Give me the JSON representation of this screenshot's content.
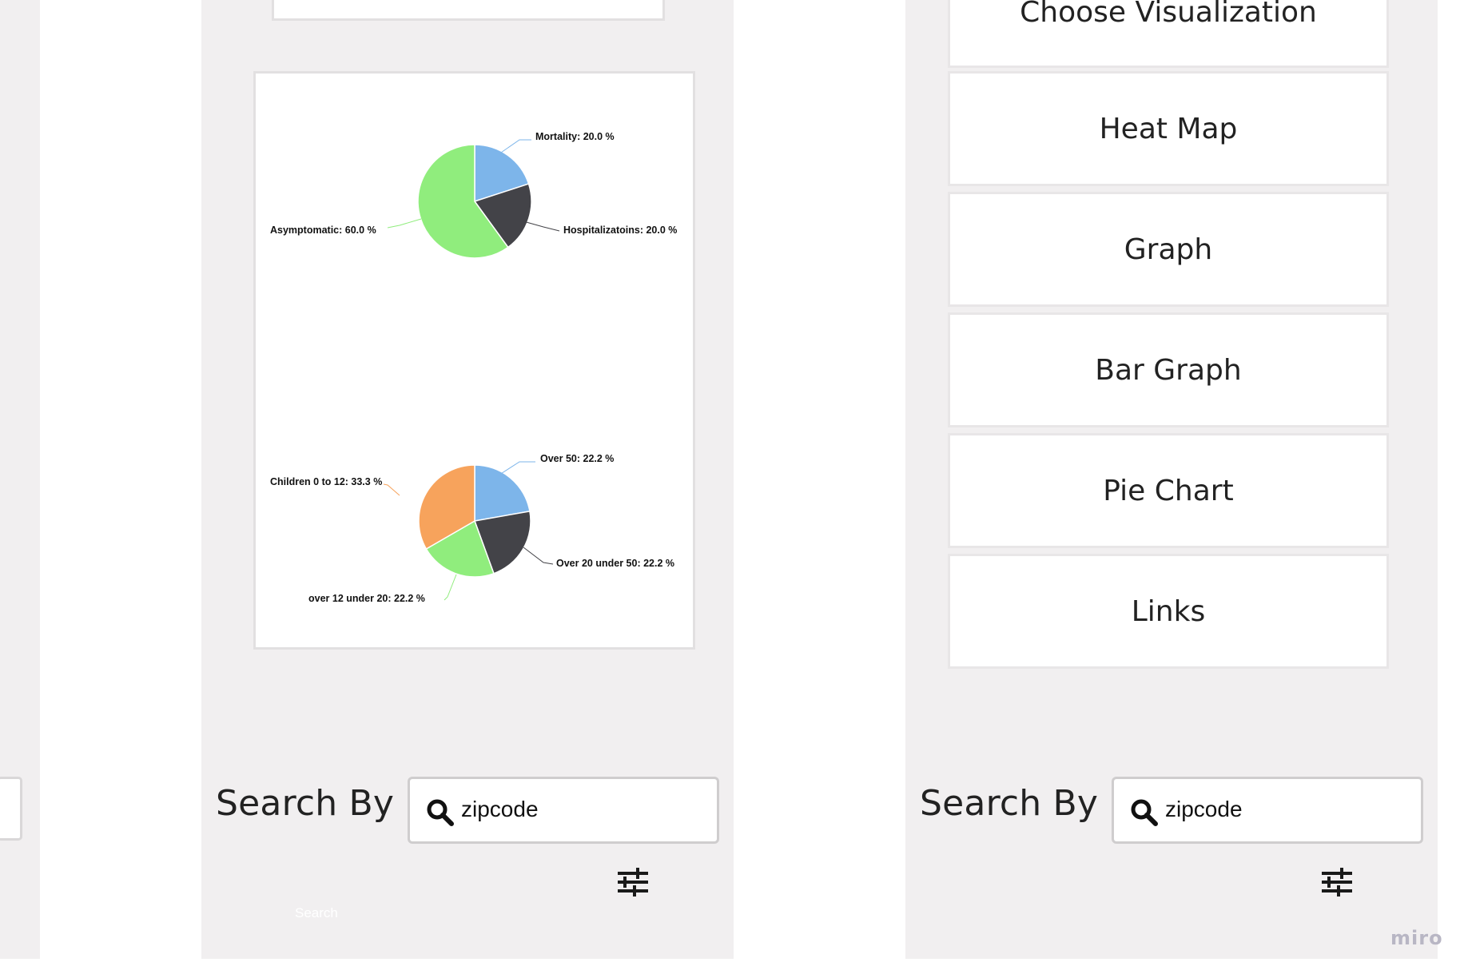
{
  "left_panel": {
    "search_label": "Search By",
    "search_value": "zipcode",
    "search_button_text": "Search"
  },
  "pie_charts": [
    {
      "slices": [
        {
          "label": "Mortality: 20.0 %",
          "value": 20.0,
          "color": "#7db5ea"
        },
        {
          "label": "Hospitalizatoins: 20.0 %",
          "value": 20.0,
          "color": "#434348"
        },
        {
          "label": "Asymptomatic: 60.0 %",
          "value": 60.0,
          "color": "#90ed7d"
        }
      ]
    },
    {
      "slices": [
        {
          "label": "Over 50: 22.2 %",
          "value": 22.2,
          "color": "#7db5ea"
        },
        {
          "label": "Over 20 under 50: 22.2 %",
          "value": 22.2,
          "color": "#434348"
        },
        {
          "label": "over 12 under 20: 22.2 %",
          "value": 22.2,
          "color": "#90ed7d"
        },
        {
          "label": "Children 0 to 12: 33.3 %",
          "value": 33.3,
          "color": "#f7a35c"
        }
      ]
    }
  ],
  "chart_data": [
    {
      "type": "pie",
      "categories": [
        "Mortality",
        "Hospitalizatoins",
        "Asymptomatic"
      ],
      "values": [
        20.0,
        20.0,
        60.0
      ]
    },
    {
      "type": "pie",
      "categories": [
        "Over 50",
        "Over 20 under 50",
        "over 12 under 20",
        "Children 0 to 12"
      ],
      "values": [
        22.2,
        22.2,
        22.2,
        33.3
      ]
    }
  ],
  "right_panel": {
    "menu": {
      "header": "Choose Visualization",
      "items": [
        "Heat Map",
        "Graph",
        "Bar Graph",
        "Pie Chart",
        "Links"
      ]
    },
    "search_label": "Search By",
    "search_value": "zipcode"
  },
  "watermark": "miro"
}
